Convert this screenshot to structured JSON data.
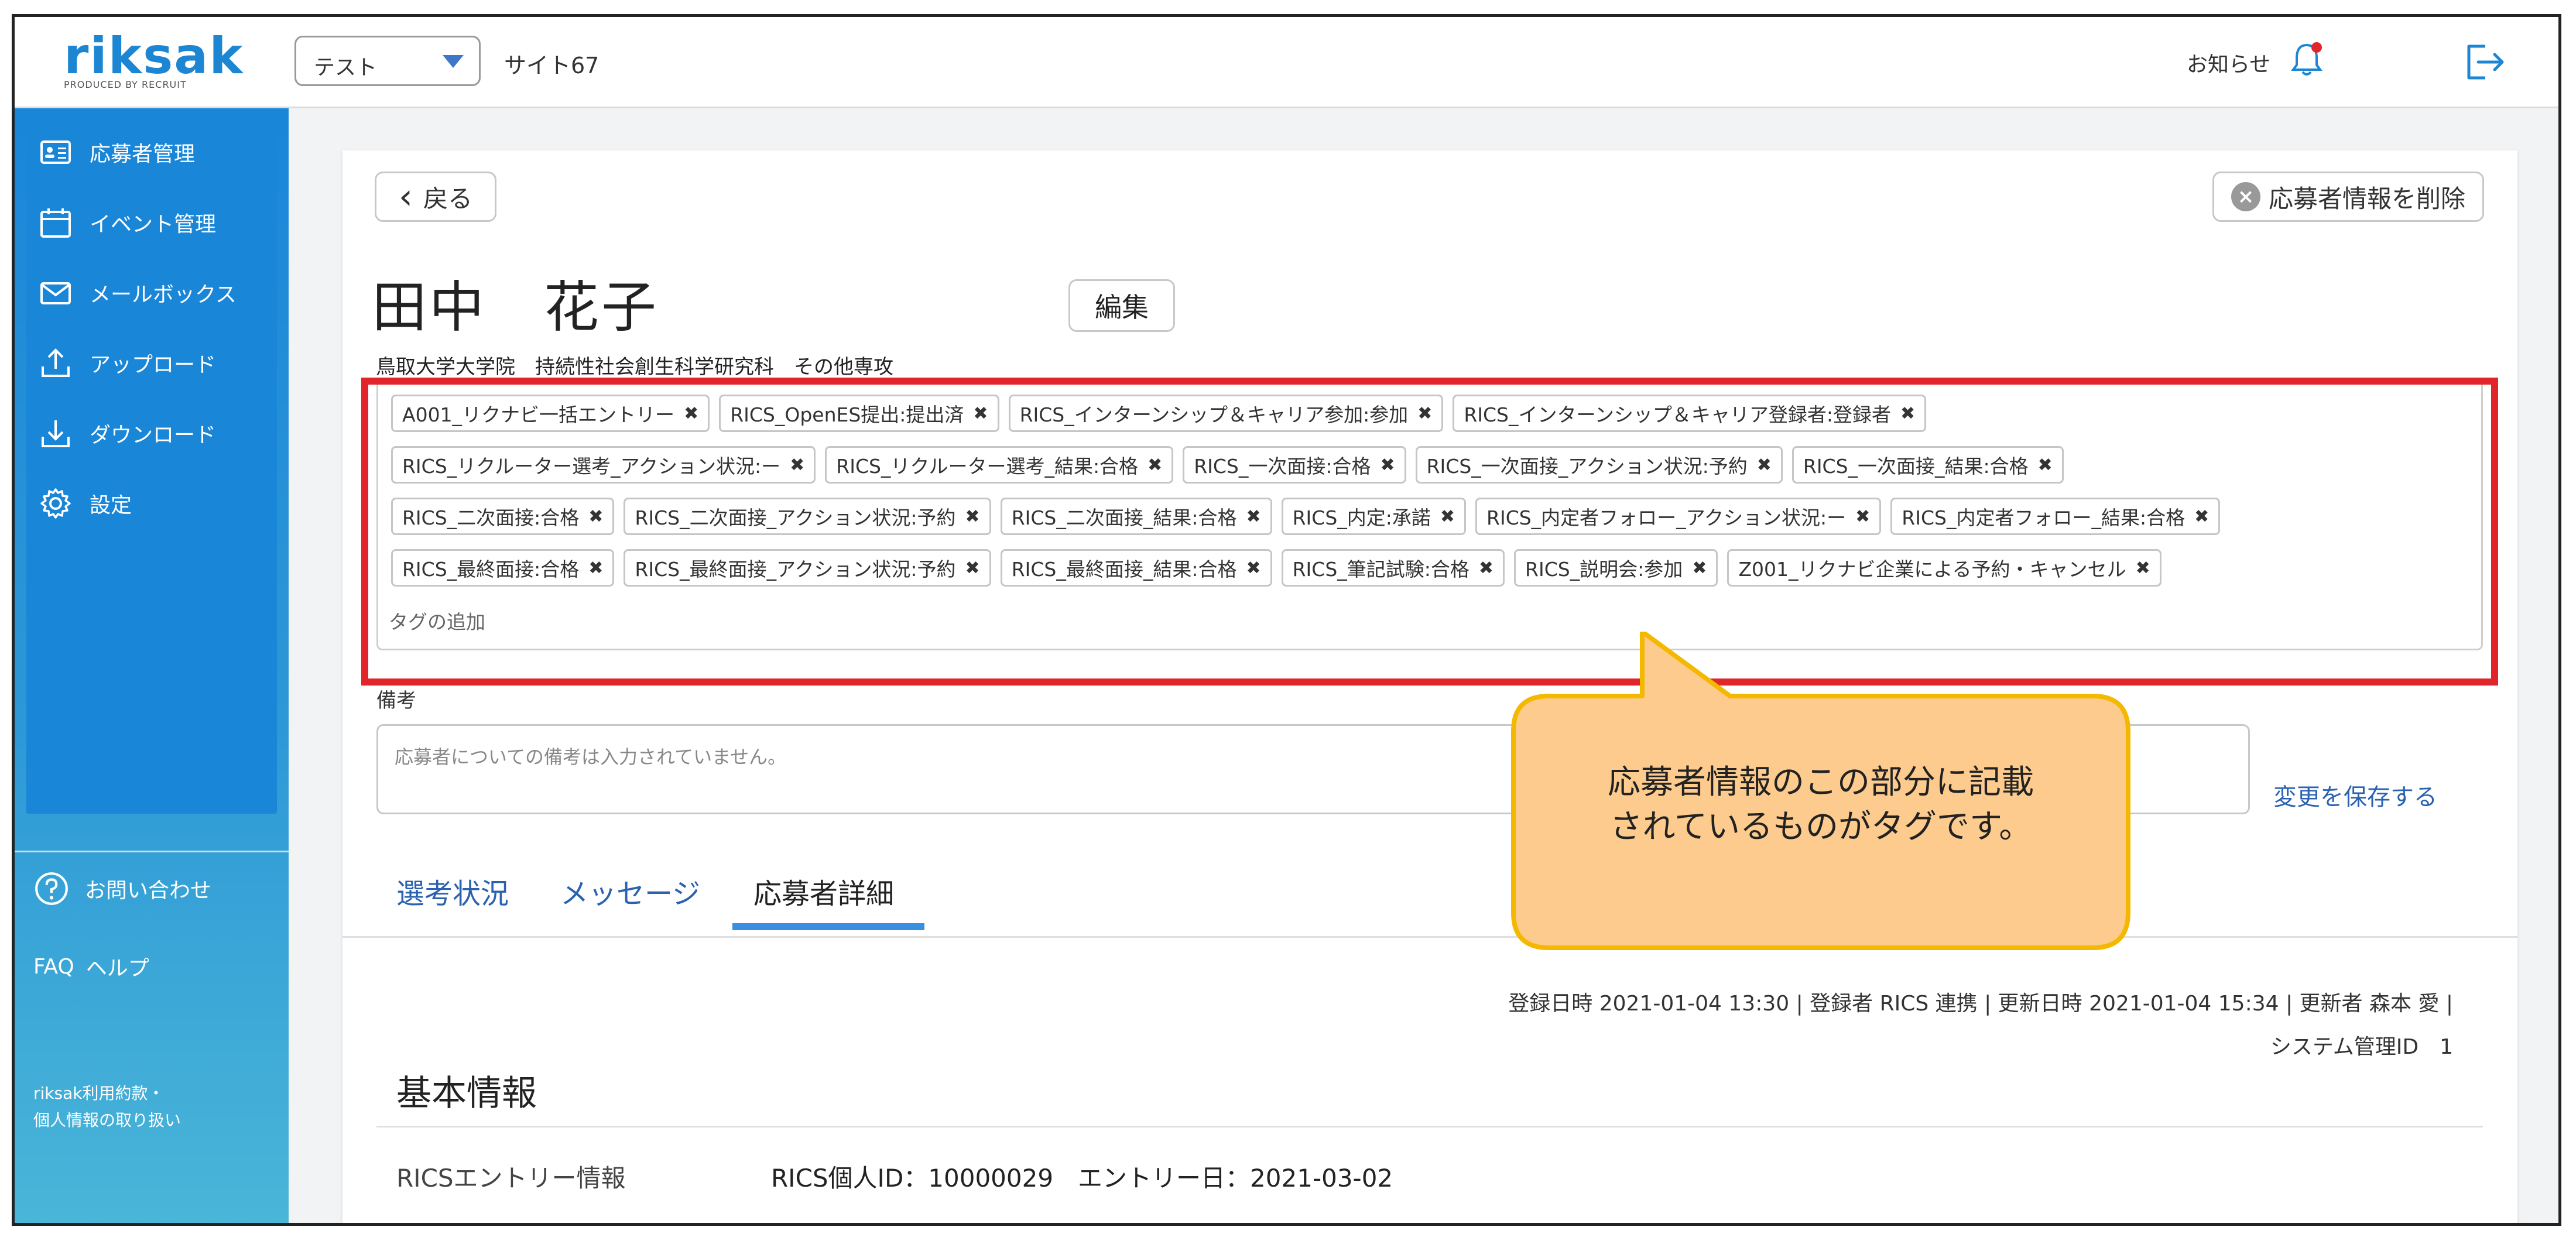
{
  "header": {
    "logo_text": "riksak",
    "logo_sub": "PRODUCED BY RECRUIT",
    "env_select": "テスト",
    "site_name": "サイト67",
    "news_label": "お知らせ"
  },
  "sidebar": {
    "items": [
      {
        "label": "応募者管理",
        "icon": "applicant-card-icon"
      },
      {
        "label": "イベント管理",
        "icon": "calendar-icon"
      },
      {
        "label": "メールボックス",
        "icon": "mail-icon"
      },
      {
        "label": "アップロード",
        "icon": "upload-icon"
      },
      {
        "label": "ダウンロード",
        "icon": "download-icon"
      },
      {
        "label": "設定",
        "icon": "gear-icon"
      }
    ],
    "contact": "お問い合わせ",
    "faq_prefix": "FAQ",
    "faq_label": "ヘルプ",
    "legal_line1": "riksak利用約款・",
    "legal_line2": "個人情報の取り扱い"
  },
  "main": {
    "back_label": "戻る",
    "delete_label": "応募者情報を削除",
    "applicant_name": "田中　花子",
    "edit_label": "編集",
    "affiliation": "鳥取大学大学院　持続性社会創生科学研究科　その他専攻",
    "tag_rows": [
      [
        "A001_リクナビ一括エントリー",
        "RICS_OpenES提出:提出済",
        "RICS_インターンシップ＆キャリア参加:参加",
        "RICS_インターンシップ＆キャリア登録者:登録者"
      ],
      [
        "RICS_リクルーター選考_アクション状況:ー",
        "RICS_リクルーター選考_結果:合格",
        "RICS_一次面接:合格",
        "RICS_一次面接_アクション状況:予約",
        "RICS_一次面接_結果:合格"
      ],
      [
        "RICS_二次面接:合格",
        "RICS_二次面接_アクション状況:予約",
        "RICS_二次面接_結果:合格",
        "RICS_内定:承諾",
        "RICS_内定者フォロー_アクション状況:ー",
        "RICS_内定者フォロー_結果:合格"
      ],
      [
        "RICS_最終面接:合格",
        "RICS_最終面接_アクション状況:予約",
        "RICS_最終面接_結果:合格",
        "RICS_筆記試験:合格",
        "RICS_説明会:参加",
        "Z001_リクナビ企業による予約・キャンセル"
      ]
    ],
    "add_tag": "タグの追加",
    "notes_label": "備考",
    "notes_placeholder": "応募者についての備考は入力されていません。",
    "save_label": "変更を保存する",
    "tabs": [
      "選考状況",
      "メッセージ",
      "応募者詳細"
    ],
    "active_tab": "応募者詳細",
    "meta_line1": "登録日時 2021-01-04 13:30 | 登録者 RICS 連携 | 更新日時 2021-01-04 15:34 | 更新者 森本 愛 |",
    "meta_line2": "システム管理ID　1",
    "section_title": "基本情報",
    "entry_label": "RICSエントリー情報",
    "entry_value": "RICS個人ID：10000029　エントリー日：2021-03-02"
  },
  "callout": {
    "line1": "応募者情報のこの部分に記載",
    "line2": "されているものがタグです。"
  },
  "colors": {
    "brand": "#1c86d3",
    "highlight": "#e0262a",
    "callout_fill": "#fdcb8e",
    "callout_border": "#f5b800",
    "link": "#2a62b0"
  }
}
